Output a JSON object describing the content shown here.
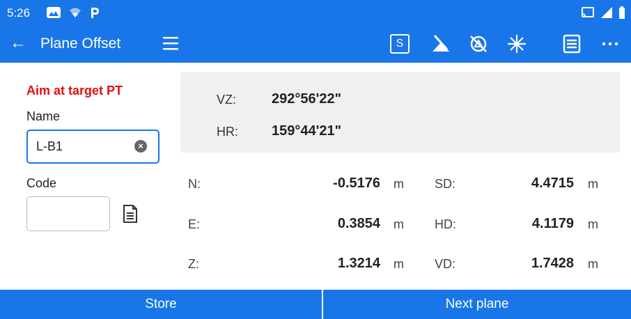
{
  "status_bar": {
    "time": "5:26"
  },
  "toolbar": {
    "back_icon": "arrow-left-icon",
    "title": "Plane Offset",
    "s_label": "S"
  },
  "form": {
    "heading": "Aim at target PT",
    "name_label": "Name",
    "name_value": "L-B1",
    "code_label": "Code",
    "code_value": ""
  },
  "angles": [
    {
      "label": "VZ:",
      "value": "292°56'22\""
    },
    {
      "label": "HR:",
      "value": "159°44'21\""
    }
  ],
  "measurements": {
    "left": [
      {
        "label": "N:",
        "value": "-0.5176",
        "unit": "m"
      },
      {
        "label": "E:",
        "value": "0.3854",
        "unit": "m"
      },
      {
        "label": "Z:",
        "value": "1.3214",
        "unit": "m"
      }
    ],
    "right": [
      {
        "label": "SD:",
        "value": "4.4715",
        "unit": "m"
      },
      {
        "label": "HD:",
        "value": "4.1179",
        "unit": "m"
      },
      {
        "label": "VD:",
        "value": "1.7428",
        "unit": "m"
      }
    ]
  },
  "buttons": {
    "store": "Store",
    "next_plane": "Next plane"
  },
  "colors": {
    "primary": "#1976e8",
    "alert": "#e01010",
    "panel": "#f0f0f0"
  }
}
